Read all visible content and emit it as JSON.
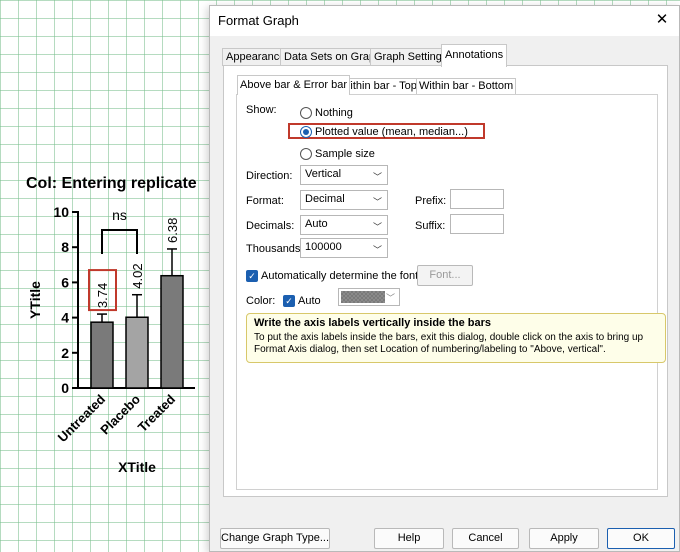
{
  "graph": {
    "title": "Col: Entering replicate",
    "ytitle": "YTitle",
    "xtitle": "XTitle",
    "significance_label": "ns",
    "chart_data": {
      "type": "bar",
      "title": "Col: Entering replicate",
      "xlabel": "XTitle",
      "ylabel": "YTitle",
      "ylim": [
        0,
        10
      ],
      "yticks": [
        0,
        2,
        4,
        6,
        8,
        10
      ],
      "categories": [
        "Untreated",
        "Placebo",
        "Treated"
      ],
      "values": [
        3.74,
        4.02,
        6.38
      ],
      "value_labels": [
        "3.74",
        "4.02",
        "6.38"
      ],
      "error_upper": [
        4.2,
        5.3,
        7.9
      ],
      "error_lower": [
        3.2,
        3.0,
        4.8
      ],
      "bar_colors": [
        "#7a7a7a",
        "#a4a4a4",
        "#7a7a7a"
      ],
      "highlight_color": "#c0392b",
      "annotations": [
        {
          "text": "ns",
          "between": [
            "Untreated",
            "Placebo"
          ]
        }
      ]
    }
  },
  "dialog": {
    "title": "Format Graph",
    "tabs": [
      "Appearance",
      "Data Sets on Graph",
      "Graph Settings",
      "Annotations"
    ],
    "active_tab": "Annotations",
    "subtabs": [
      "Above bar & Error bar",
      "Within bar - Top",
      "Within bar - Bottom"
    ],
    "show": {
      "label": "Show:",
      "options": [
        "Nothing",
        "Plotted value (mean, median...)",
        "Sample size"
      ],
      "selected": "Plotted value (mean, median...)"
    },
    "direction": {
      "label": "Direction:",
      "value": "Vertical"
    },
    "format": {
      "label": "Format:",
      "value": "Decimal"
    },
    "decimals": {
      "label": "Decimals:",
      "value": "Auto"
    },
    "thousands": {
      "label": "Thousands:",
      "value": "100000"
    },
    "prefix": {
      "label": "Prefix:",
      "value": ""
    },
    "suffix": {
      "label": "Suffix:",
      "value": ""
    },
    "auto_font": {
      "label": "Automatically determine the font",
      "checked": true
    },
    "font_button": "Font...",
    "color": {
      "label": "Color:",
      "auto_label": "Auto",
      "auto_checked": true
    },
    "tip": {
      "title": "Write the axis labels vertically inside the bars",
      "body": "To put the axis labels inside the bars, exit this dialog, double click on the axis to bring up Format Axis dialog, then set Location of numbering/labeling to \"Above, vertical\"."
    },
    "buttons": {
      "change_graph_type": "Change Graph Type...",
      "help": "Help",
      "cancel": "Cancel",
      "apply": "Apply",
      "ok": "OK"
    }
  },
  "colors": {
    "accent": "#1b5fb0",
    "highlight_border": "#c0392b",
    "tip_background": "#fefee9"
  }
}
